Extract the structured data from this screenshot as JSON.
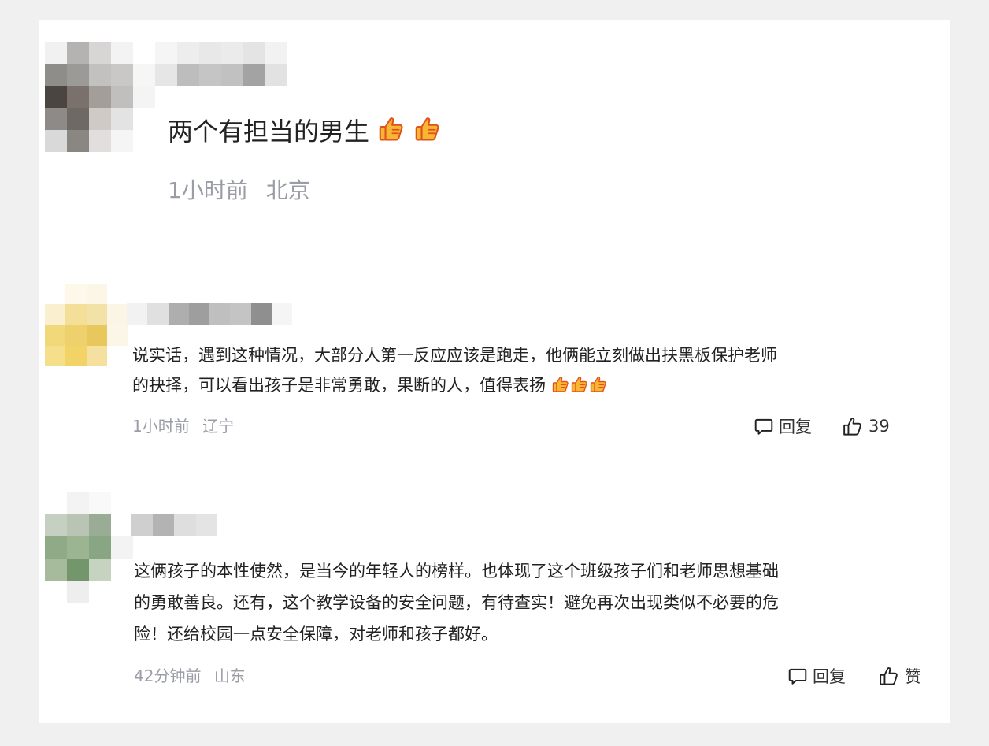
{
  "comments": [
    {
      "text": "两个有担当的男生",
      "emoji_count": 2,
      "time": "1小时前",
      "location": "北京"
    },
    {
      "lines": [
        "说实话，遇到这种情况，大部分人第一反应应该是跑走，他俩能立刻做出扶黑板保护老师",
        "的抉择，可以看出孩子是非常勇敢，果断的人，值得表扬"
      ],
      "emoji_count": 3,
      "time": "1小时前",
      "location": "辽宁",
      "reply_label": "回复",
      "like_count": "39"
    },
    {
      "lines": [
        "这俩孩子的本性使然，是当今的年轻人的榜样。也体现了这个班级孩子们和老师思想基础",
        "的勇敢善良。还有，这个教学设备的安全问题，有待查实！避免再次出现类似不必要的危",
        "险！还给校园一点安全保障，对老师和孩子都好。"
      ],
      "time": "42分钟前",
      "location": "山东",
      "reply_label": "回复",
      "like_label": "赞"
    }
  ],
  "icons": {
    "emoji": "thumbs-up-emoji",
    "reply": "comment-bubble-icon",
    "like": "thumbs-up-outline-icon"
  }
}
